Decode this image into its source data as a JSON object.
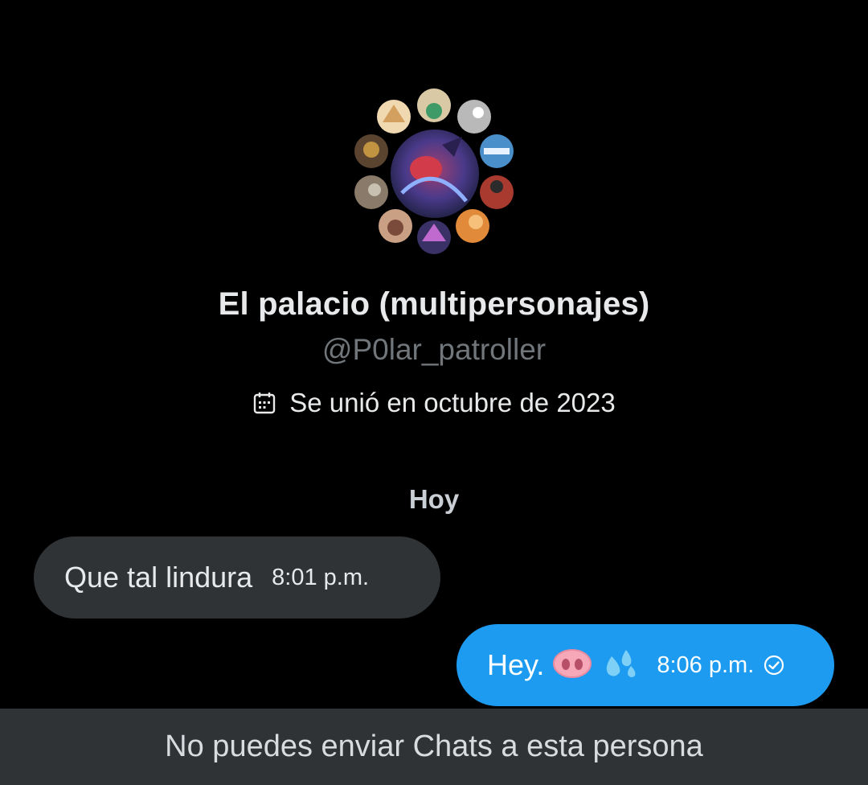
{
  "profile": {
    "display_name": "El palacio (multipersonajes)",
    "handle": "@P0lar_patroller",
    "joined": "Se unió en octubre de 2023",
    "calendar_icon": "calendar-icon"
  },
  "conversation": {
    "day_label": "Hoy",
    "messages": [
      {
        "direction": "incoming",
        "text": "Que tal lindura",
        "time": "8:01 p.m."
      },
      {
        "direction": "outgoing",
        "text": "Hey.",
        "emojis": [
          "pig-nose-emoji",
          "sweat-droplets-emoji"
        ],
        "time": "8:06 p.m.",
        "status_icon": "read-check-icon"
      }
    ]
  },
  "footer": {
    "notice": "No puedes enviar Chats a esta persona"
  },
  "colors": {
    "background": "#000000",
    "incoming_bubble": "#2f3336",
    "outgoing_bubble": "#1d9bf0",
    "secondary_text": "#71767b",
    "footer_bar": "#2f3336"
  }
}
